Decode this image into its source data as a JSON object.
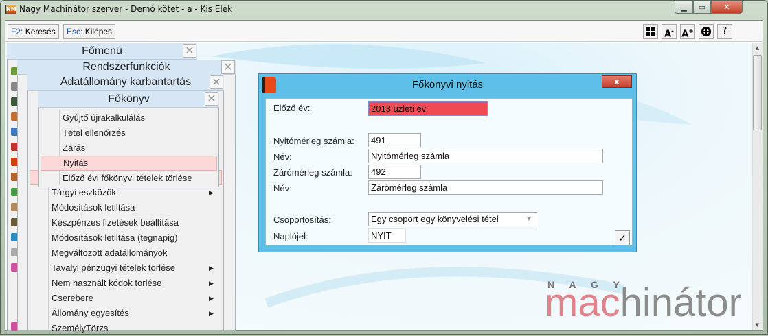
{
  "window": {
    "title": "Nagy Machinátor szerver - Demó kötet - a - Kis Elek",
    "icon": "nm-app-icon"
  },
  "toolbar": {
    "search": {
      "key": "F2:",
      "label": "Keresés"
    },
    "exit": {
      "key": "Esc:",
      "label": "Kilépés"
    },
    "icons": [
      "layout-grid-icon",
      "font-decrease-icon",
      "font-increase-icon",
      "lifebuoy-icon",
      "help-icon"
    ],
    "help_label": "?"
  },
  "menus": {
    "main": {
      "title": "Főmenü"
    },
    "system": {
      "title": "Rendszerfunkciók"
    },
    "data": {
      "title": "Adatállomány karbantartás",
      "items": [
        {
          "label": "Tárgyi eszközök",
          "sub": true
        },
        {
          "label": "Módosítások letiltása",
          "sub": false
        },
        {
          "label": "Készpénzes fizetések beállítása",
          "sub": false
        },
        {
          "label": "Módosítások letiltása (tegnapig)",
          "sub": false
        },
        {
          "label": "Megváltozott adatállományok",
          "sub": false
        },
        {
          "label": "Tavalyi pénzügyi tételek törlése",
          "sub": true
        },
        {
          "label": "Nem használt kódok törlése",
          "sub": true
        },
        {
          "label": "Cserebere",
          "sub": true
        },
        {
          "label": "Állomány egyesítés",
          "sub": true
        },
        {
          "label": "SzemélyTörzs",
          "sub": false
        }
      ]
    },
    "ledger": {
      "title": "Főkönyv",
      "items": [
        {
          "label": "Gyűjtő újrakalkulálás"
        },
        {
          "label": "Tétel ellenőrzés"
        },
        {
          "label": "Zárás"
        },
        {
          "label": "Nyitás",
          "selected": true
        },
        {
          "label": "Előző évi főkönyvi tételek törlése"
        }
      ]
    }
  },
  "dialog": {
    "title": "Főkönyvi nyitás",
    "fields": {
      "prev_year": {
        "label": "Előző év:",
        "value": "2013 üzleti év"
      },
      "open_account": {
        "label": "Nyitómérleg számla:",
        "value": "491"
      },
      "open_name": {
        "label": "Név:",
        "value": "Nyitómérleg számla"
      },
      "close_account": {
        "label": "Zárómérleg számla:",
        "value": "492"
      },
      "close_name": {
        "label": "Név:",
        "value": "Zárómérleg számla"
      },
      "grouping": {
        "label": "Csoportosítás:",
        "value": "Egy csoport egy könyvelési tétel"
      },
      "journal": {
        "label": "Naplójel:",
        "value": "NYIT"
      }
    },
    "ok_label": "✓",
    "close_label": "x"
  },
  "logo": {
    "top": "N A G Y",
    "left": "mac",
    "right": "hinátor"
  },
  "colors": {
    "dialog_title": "#5ec0e8",
    "error_field": "#f04a55",
    "menu_header": "#d7e6f5",
    "selection": "#fdd8d8"
  }
}
